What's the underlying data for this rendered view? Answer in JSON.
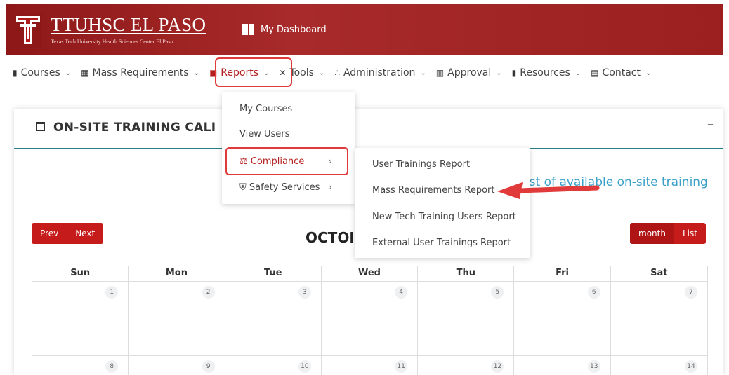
{
  "header": {
    "org_title": "TTUHSC EL PASO",
    "org_subtitle": "Texas Tech University Health Sciences Center El Paso",
    "dashboard_label": "My Dashboard",
    "brand_color": "#a32323"
  },
  "nav": {
    "items": [
      {
        "label": "Courses",
        "icon": "book-icon"
      },
      {
        "label": "Mass Requirements",
        "icon": "clipboard-icon"
      },
      {
        "label": "Reports",
        "icon": "presentation-icon"
      },
      {
        "label": "Tools",
        "icon": "tools-icon"
      },
      {
        "label": "Administration",
        "icon": "users-icon"
      },
      {
        "label": "Approval",
        "icon": "handshake-icon"
      },
      {
        "label": "Resources",
        "icon": "books-icon"
      },
      {
        "label": "Contact",
        "icon": "phone-icon"
      }
    ]
  },
  "reports_menu": {
    "items": [
      {
        "label": "My Courses"
      },
      {
        "label": "View Users"
      },
      {
        "label": "Compliance",
        "icon": "scale-icon"
      },
      {
        "label": "Safety Services",
        "icon": "shield-icon"
      }
    ]
  },
  "compliance_menu": {
    "items": [
      {
        "label": "User Trainings Report"
      },
      {
        "label": "Mass Requirements Report"
      },
      {
        "label": "New Tech Training Users Report"
      },
      {
        "label": "External User Trainings Report"
      }
    ]
  },
  "card": {
    "title": "ON-SITE TRAINING CALI",
    "minimize": "–",
    "link_text": "ist of available on-site training"
  },
  "calendar": {
    "prev_label": "Prev",
    "next_label": "Next",
    "month_title": "OCTOI",
    "month_label": "month",
    "list_label": "List",
    "weekdays": [
      "Sun",
      "Mon",
      "Tue",
      "Wed",
      "Thu",
      "Fri",
      "Sat"
    ],
    "week1": [
      "1",
      "2",
      "3",
      "4",
      "5",
      "6",
      "7"
    ],
    "week2": [
      "8",
      "9",
      "10",
      "11",
      "12",
      "13",
      "14"
    ]
  },
  "annotation": {
    "highlight_color": "#e03a3a"
  }
}
